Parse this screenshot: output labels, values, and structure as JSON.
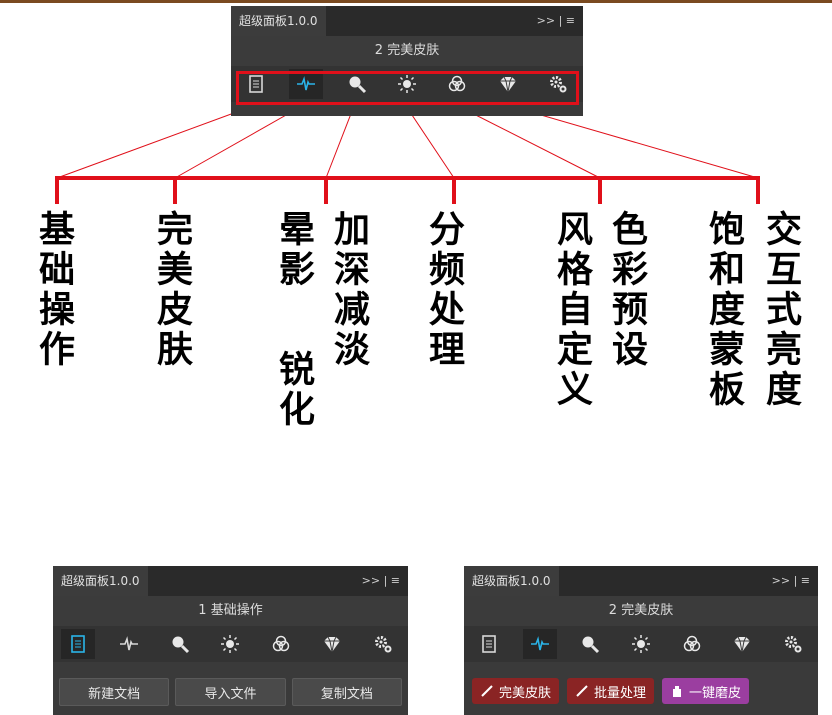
{
  "panel_top": {
    "title": "超级面板1.0.0",
    "menu": ">>  |  ≡",
    "subtitle": "2 完美皮肤"
  },
  "icons": [
    {
      "name": "document-icon"
    },
    {
      "name": "pulse-icon"
    },
    {
      "name": "magnifier-icon"
    },
    {
      "name": "sun-icon"
    },
    {
      "name": "rgb-circles-icon"
    },
    {
      "name": "diamond-icon"
    },
    {
      "name": "gears-icon"
    }
  ],
  "labels": [
    {
      "text": "基础操作"
    },
    {
      "text": "完美皮肤"
    },
    {
      "text": "晕影"
    },
    {
      "text": "锐化"
    },
    {
      "text": "加深减淡"
    },
    {
      "text": "分频处理"
    },
    {
      "text": "风格自定义"
    },
    {
      "text": "色彩预设"
    },
    {
      "text": "饱和度蒙板"
    },
    {
      "text": "交互式亮度"
    }
  ],
  "panel_bl": {
    "title": "超级面板1.0.0",
    "menu": ">>  |  ≡",
    "subtitle": "1 基础操作",
    "buttons": [
      "新建文档",
      "导入文件",
      "复制文档"
    ]
  },
  "panel_br": {
    "title": "超级面板1.0.0",
    "menu": ">>  |  ≡",
    "subtitle": "2 完美皮肤",
    "buttons": [
      "完美皮肤",
      "批量处理",
      "一键磨皮"
    ]
  },
  "colors": {
    "accent_red": "#e0101a",
    "active_cyan": "#2ab4e8",
    "button_red": "#8a2424",
    "button_purple": "#9b3ea0"
  }
}
